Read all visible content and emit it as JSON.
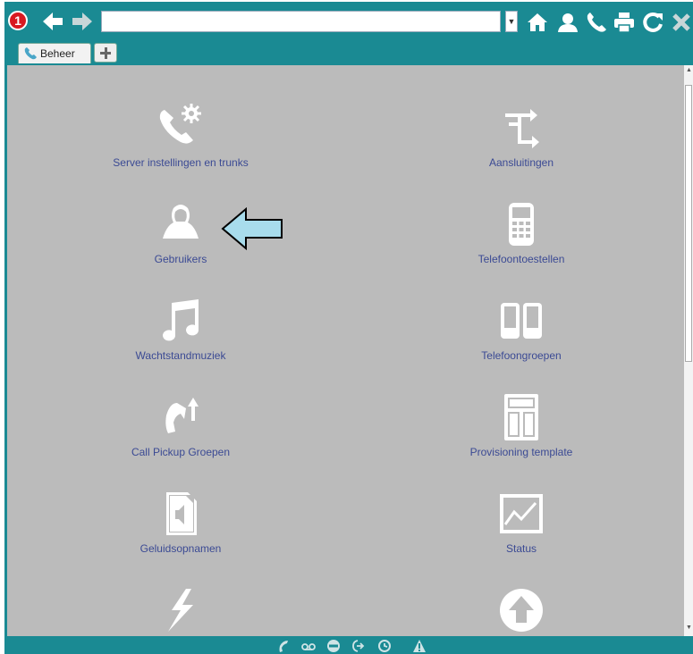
{
  "toolbar": {
    "notification_count": "1",
    "address_value": "",
    "icons": [
      "back-icon",
      "forward-icon",
      "home-icon",
      "users-icon",
      "phone-icon",
      "print-icon",
      "refresh-icon",
      "close-icon"
    ]
  },
  "tabs": [
    {
      "label": "Beheer",
      "icon": "phone-icon"
    }
  ],
  "menu": {
    "left": [
      {
        "label": "Server instellingen en trunks",
        "icon": "phone-gear-icon"
      },
      {
        "label": "Gebruikers",
        "icon": "users-icon"
      },
      {
        "label": "Wachtstandmuziek",
        "icon": "music-note-icon"
      },
      {
        "label": "Call Pickup Groepen",
        "icon": "call-pickup-icon"
      },
      {
        "label": "Geluidsopnamen",
        "icon": "sound-file-icon"
      },
      {
        "label": "",
        "icon": "lightning-icon"
      }
    ],
    "right": [
      {
        "label": "Aansluitingen",
        "icon": "connections-icon"
      },
      {
        "label": "Telefoontoestellen",
        "icon": "deskphone-icon"
      },
      {
        "label": "Telefoongroepen",
        "icon": "phone-group-icon"
      },
      {
        "label": "Provisioning template",
        "icon": "template-icon"
      },
      {
        "label": "Status",
        "icon": "status-chart-icon"
      },
      {
        "label": "",
        "icon": "upload-icon"
      }
    ]
  },
  "statusbar": {
    "icons": [
      "handset-icon",
      "voicemail-icon",
      "dnd-icon",
      "forward-call-icon",
      "history-icon",
      "warning-icon"
    ]
  },
  "colors": {
    "teal": "#1a8a93",
    "content_bg": "#bbbbbb",
    "link": "#3b4a94",
    "badge": "#d81921",
    "pointer": "#a8dcec"
  }
}
